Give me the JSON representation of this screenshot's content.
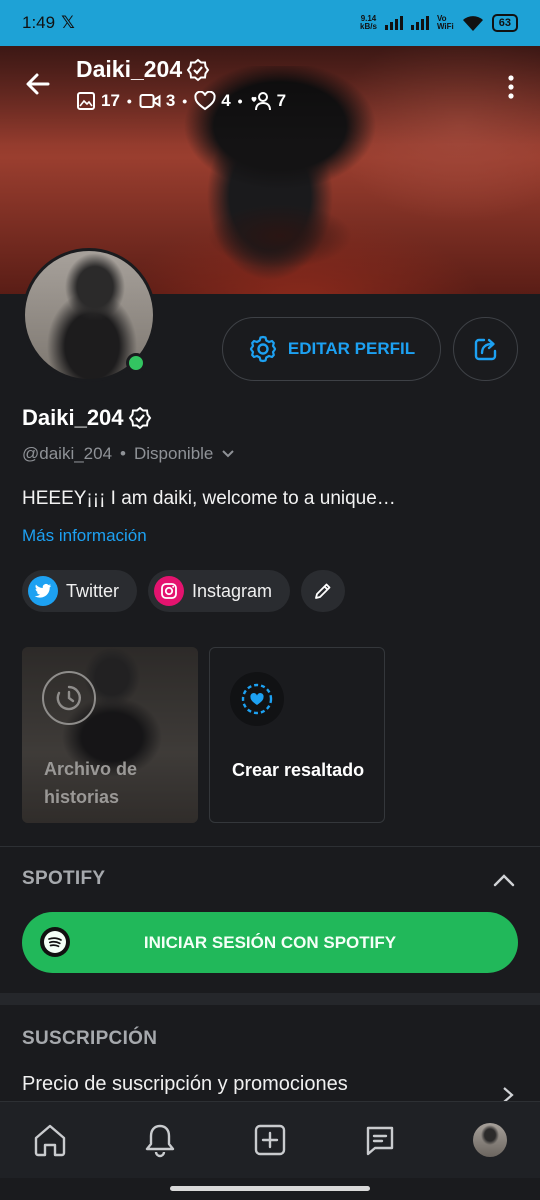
{
  "status_bar": {
    "time": "1:49",
    "x_glyph": "𝕏",
    "net_speed_value": "9.14",
    "net_speed_unit": "kB/s",
    "vowifi_top": "Vo",
    "vowifi_bottom": "WiFi",
    "battery": "63"
  },
  "header": {
    "title": "Daiki_204",
    "stats": {
      "photos": "17",
      "videos": "3",
      "likes": "4",
      "subscribers": "7"
    }
  },
  "profile": {
    "name": "Daiki_204",
    "handle": "@daiki_204",
    "separator": "•",
    "availability": "Disponible",
    "bio": "HEEEY¡¡¡ I am daiki, welcome to a unique…",
    "more_link": "Más información",
    "edit_label": "EDITAR PERFIL"
  },
  "socials": [
    {
      "label": "Twitter",
      "color": "#1da1f2"
    },
    {
      "label": "Instagram",
      "color": "#e4136f"
    }
  ],
  "highlights": {
    "archive_label": "Archivo de historias",
    "create_label": "Crear resaltado"
  },
  "spotify": {
    "section_title": "SPOTIFY",
    "button_label": "INICIAR SESIÓN CON SPOTIFY",
    "color": "#21b85a"
  },
  "subscription": {
    "section_title": "SUSCRIPCIÓN",
    "row_label": "Precio de suscripción y promociones"
  },
  "nav": {
    "items": [
      "home-icon",
      "bell-icon",
      "plus-square-icon",
      "messages-icon",
      "profile-avatar"
    ]
  },
  "colors": {
    "accent": "#1da1f2",
    "status_bar": "#1ea2d6",
    "online": "#33c561",
    "background": "#1a1b1e"
  }
}
